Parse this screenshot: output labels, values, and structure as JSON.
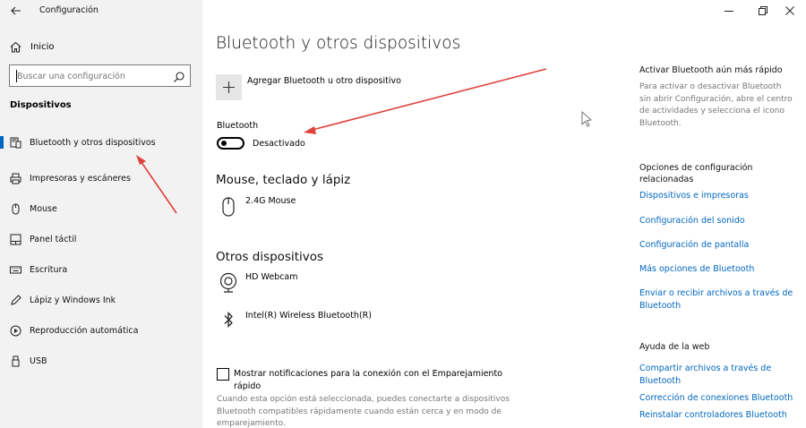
{
  "app": {
    "title": "Configuración"
  },
  "sidebar": {
    "home_label": "Inicio",
    "search_placeholder": "Buscar una configuración",
    "section_title": "Dispositivos",
    "items": [
      {
        "label": "Bluetooth y otros dispositivos",
        "icon": "bluetooth-devices-icon",
        "active": true
      },
      {
        "label": "Impresoras y escáneres",
        "icon": "printer-icon"
      },
      {
        "label": "Mouse",
        "icon": "mouse-icon"
      },
      {
        "label": "Panel táctil",
        "icon": "touchpad-icon"
      },
      {
        "label": "Escritura",
        "icon": "keyboard-icon"
      },
      {
        "label": "Lápiz y Windows Ink",
        "icon": "pen-icon"
      },
      {
        "label": "Reproducción automática",
        "icon": "autoplay-icon"
      },
      {
        "label": "USB",
        "icon": "usb-icon"
      }
    ]
  },
  "main": {
    "title": "Bluetooth y otros dispositivos",
    "add_device_label": "Agregar Bluetooth u otro dispositivo",
    "bluetooth_label": "Bluetooth",
    "bluetooth_state": "Desactivado",
    "mouse_section": "Mouse, teclado y lápiz",
    "mouse_device": "2.4G Mouse",
    "other_section": "Otros dispositivos",
    "other_devices": [
      {
        "label": "HD Webcam",
        "icon": "webcam-icon"
      },
      {
        "label": "Intel(R) Wireless Bluetooth(R)",
        "icon": "bluetooth-icon"
      }
    ],
    "swift_pair_label": "Mostrar notificaciones para la conexión con el Emparejamiento rápido",
    "swift_pair_desc": "Cuando esta opción está seleccionada, puedes conectarte a dispositivos Bluetooth compatibles rápidamente cuando están cerca y en modo de emparejamiento."
  },
  "rail": {
    "faster_title": "Activar Bluetooth aún más rápido",
    "faster_desc": "Para activar o desactivar Bluetooth sin abrir Configuración, abre el centro de actividades y selecciona el icono Bluetooth.",
    "related_title": "Opciones de configuración relacionadas",
    "related_links": [
      "Dispositivos e impresoras",
      "Configuración del sonido",
      "Configuración de pantalla",
      "Más opciones de Bluetooth",
      "Enviar o recibir archivos a través de Bluetooth"
    ],
    "help_title": "Ayuda de la web",
    "help_links": [
      "Compartir archivos a través de Bluetooth",
      "Corrección de conexiones Bluetooth",
      "Reinstalar controladores Bluetooth"
    ]
  },
  "colors": {
    "accent": "#0067c0",
    "sidebar_bg": "#f2f2f2",
    "annotation_arrow": "#e0413b"
  }
}
